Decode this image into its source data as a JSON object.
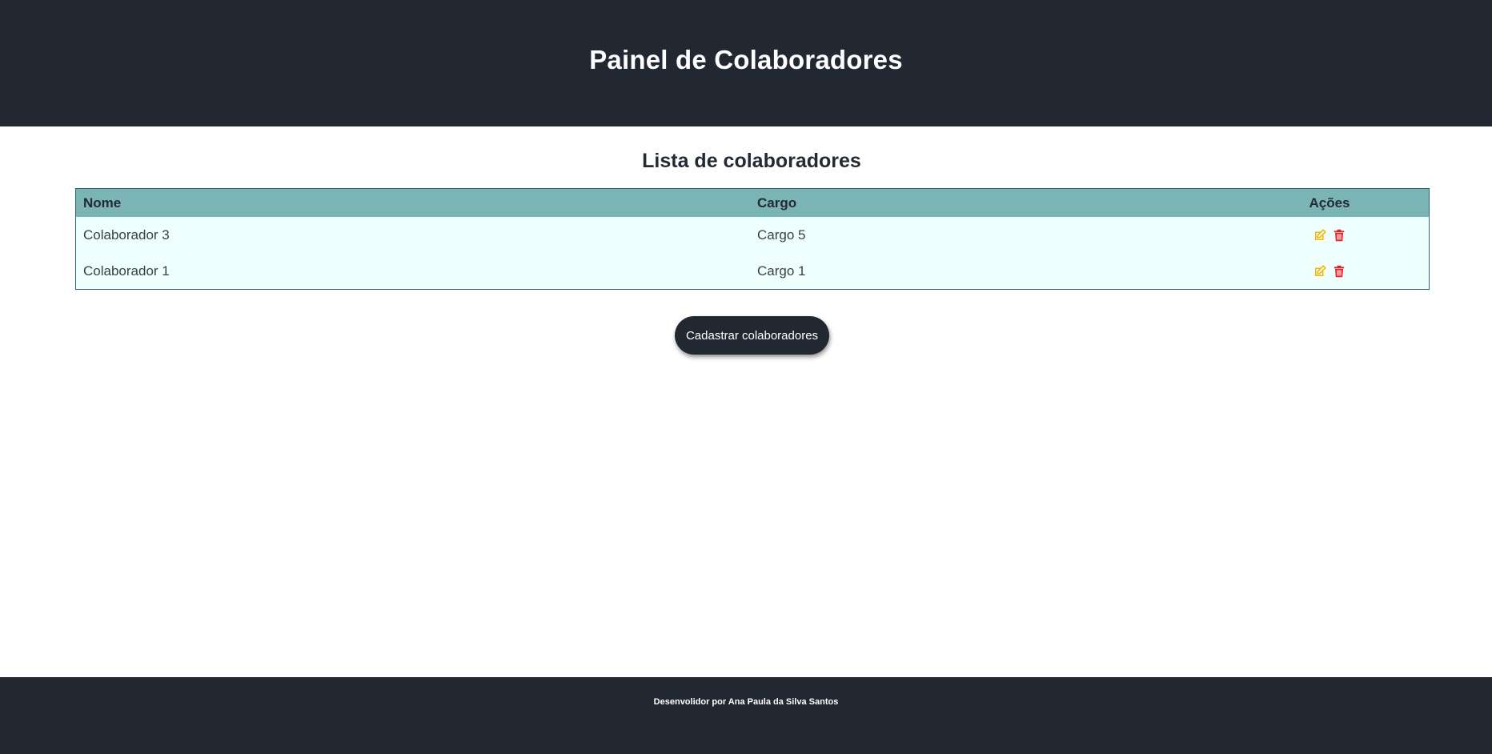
{
  "header": {
    "title": "Painel de Colaboradores"
  },
  "main": {
    "section_title": "Lista de colaboradores",
    "table": {
      "columns": [
        "Nome",
        "Cargo",
        "Ações"
      ],
      "rows": [
        {
          "nome": "Colaborador 3",
          "cargo": "Cargo 5",
          "actions": [
            "edit-icon",
            "trash-icon"
          ]
        },
        {
          "nome": "Colaborador 1",
          "cargo": "Cargo 1",
          "actions": [
            "edit-icon",
            "trash-icon"
          ]
        }
      ]
    },
    "register_button_label": "Cadastrar colaboradores"
  },
  "footer": {
    "credit": "Desenvolidor por Ana Paula da Silva Santos"
  },
  "colors": {
    "header_bg": "#222831",
    "table_header_bg": "#7ab4b5",
    "table_body_bg": "#effffe",
    "edit_icon": "#f5b800",
    "delete_icon": "#e02424"
  }
}
